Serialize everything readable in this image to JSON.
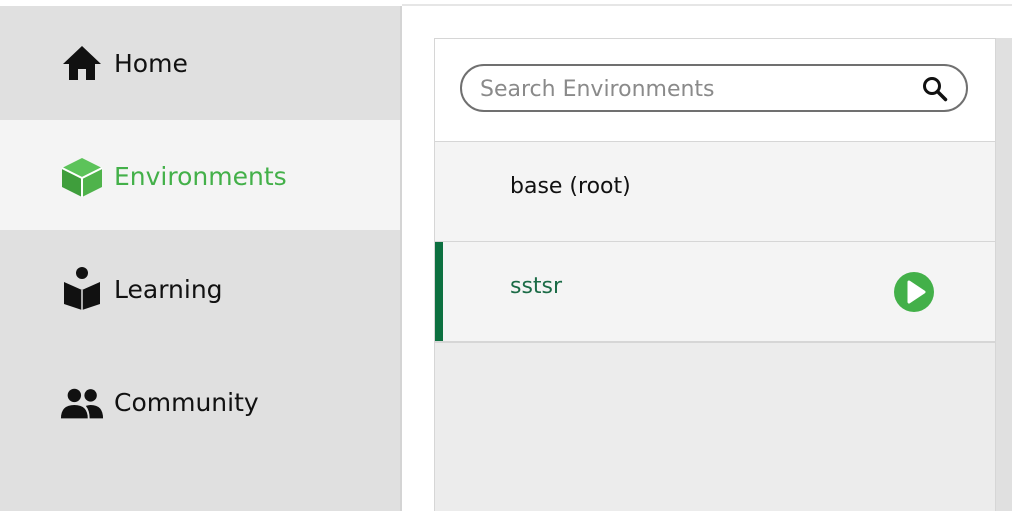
{
  "sidebar": {
    "items": [
      {
        "label": "Home",
        "icon": "home-icon",
        "active": false
      },
      {
        "label": "Environments",
        "icon": "cube-icon",
        "active": true
      },
      {
        "label": "Learning",
        "icon": "book-reader-icon",
        "active": false
      },
      {
        "label": "Community",
        "icon": "people-icon",
        "active": false
      }
    ]
  },
  "search": {
    "placeholder": "Search Environments",
    "value": "",
    "icon": "search-icon"
  },
  "environments": [
    {
      "name": "base (root)",
      "selected": false
    },
    {
      "name": "sstsr",
      "selected": true,
      "action_icon": "play-icon"
    }
  ],
  "colors": {
    "accent_green": "#43b049",
    "selected_bar": "#0c7040",
    "selected_text": "#1b6b46",
    "sidebar_bg": "#e0e0e0",
    "active_item_bg": "#f4f4f4"
  }
}
